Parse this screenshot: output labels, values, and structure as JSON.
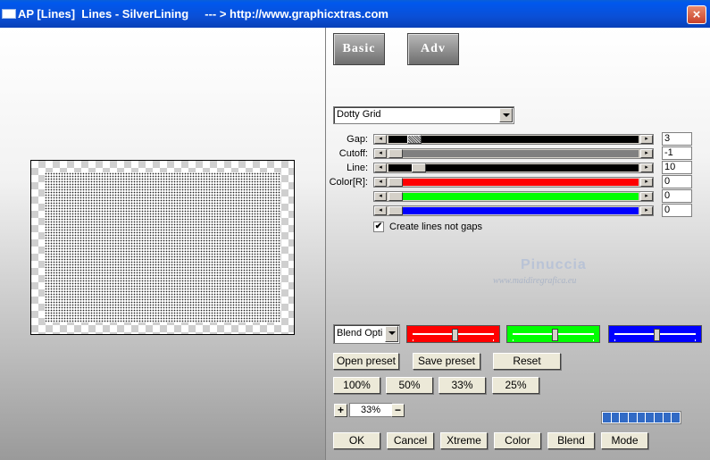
{
  "window": {
    "title": "AP [Lines]  Lines - SilverLining     --- > http://www.graphicxtras.com",
    "close": "×"
  },
  "tabs": {
    "basic": "Basic",
    "adv": "Adv"
  },
  "effect_select": {
    "value": "Dotty Grid"
  },
  "params": [
    {
      "label": "Gap:",
      "value": "3",
      "color": "#000000",
      "level": 0.05
    },
    {
      "label": "Cutoff:",
      "value": "-1",
      "color": "#808080",
      "level": 0.0
    },
    {
      "label": "Line:",
      "value": "10",
      "color": "#000000",
      "level": 0.06
    },
    {
      "label": "Color[R]:",
      "value": "0",
      "color": "#ff0000",
      "level": 0.0
    },
    {
      "label": "",
      "value": "0",
      "color": "#00ff00",
      "level": 0.0
    },
    {
      "label": "",
      "value": "0",
      "color": "#0000ff",
      "level": 0.0
    }
  ],
  "arrows": {
    "left": "◂",
    "right": "▸"
  },
  "checkbox": {
    "label": "Create lines not gaps",
    "checked": "✔"
  },
  "watermark": {
    "name": "Pinuccia",
    "site": "www.maidiregrafica.eu"
  },
  "blend": {
    "value": "Blend Opti"
  },
  "color_bars": [
    {
      "color": "#ff0000",
      "level": 0.5
    },
    {
      "color": "#00ff00",
      "level": 0.5
    },
    {
      "color": "#0000ff",
      "level": 0.5
    }
  ],
  "preset_buttons": {
    "open": "Open preset",
    "save": "Save preset",
    "reset": "Reset"
  },
  "zoom_buttons": [
    "100%",
    "50%",
    "33%",
    "25%"
  ],
  "zoom": {
    "plus": "+",
    "value": "33%",
    "minus": "−"
  },
  "bottom_buttons": [
    "OK",
    "Cancel",
    "Xtreme",
    "Color",
    "Blend",
    "Mode"
  ]
}
